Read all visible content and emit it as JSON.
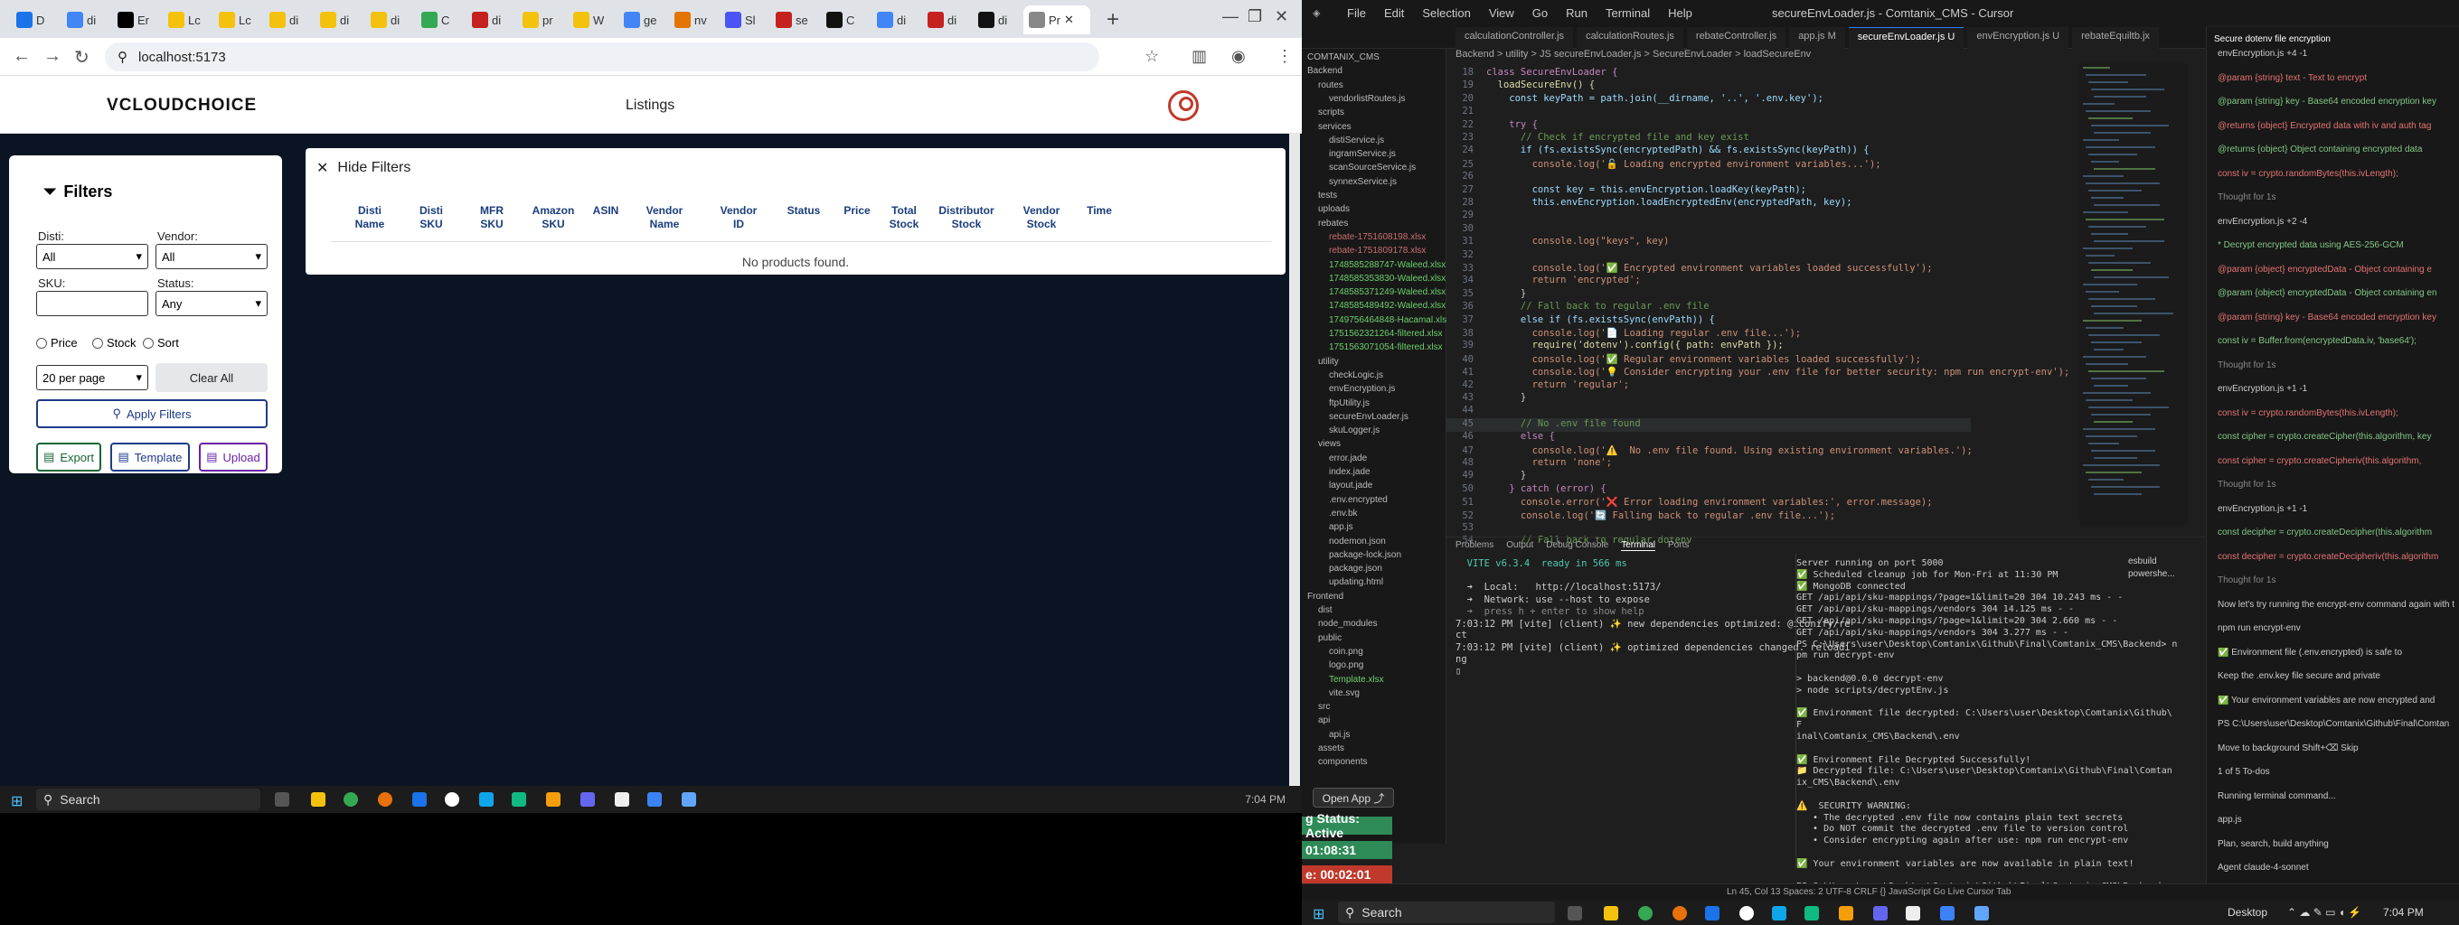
{
  "browser": {
    "tabs": [
      {
        "label": "D",
        "color": "#1a73e8"
      },
      {
        "label": "di",
        "color": "#4285f4"
      },
      {
        "label": "Er",
        "color": "#000000"
      },
      {
        "label": "Lc",
        "color": "#f4c20d"
      },
      {
        "label": "Lc",
        "color": "#f4c20d"
      },
      {
        "label": "di",
        "color": "#f4c20d"
      },
      {
        "label": "di",
        "color": "#f4c20d"
      },
      {
        "label": "di",
        "color": "#f4c20d"
      },
      {
        "label": "C",
        "color": "#34a853"
      },
      {
        "label": "di",
        "color": "#c5221f"
      },
      {
        "label": "pr",
        "color": "#f4c20d"
      },
      {
        "label": "W",
        "color": "#f4c20d"
      },
      {
        "label": "ge",
        "color": "#4285f4"
      },
      {
        "label": "nv",
        "color": "#e37400"
      },
      {
        "label": "Sl",
        "color": "#4b53f5"
      },
      {
        "label": "se",
        "color": "#c5221f"
      },
      {
        "label": "C",
        "color": "#111111"
      },
      {
        "label": "di",
        "color": "#4285f4"
      },
      {
        "label": "di",
        "color": "#c5221f"
      },
      {
        "label": "di",
        "color": "#111111"
      },
      {
        "label": "Pr",
        "color": "#888888"
      }
    ],
    "url": "localhost:5173"
  },
  "app": {
    "logo": {
      "v": "V",
      "text": "CLOUDCHOICE"
    },
    "nav_title": "Listings",
    "filters": {
      "title": "Filters",
      "disti_label": "Disti:",
      "disti_value": "All",
      "vendor_label": "Vendor:",
      "vendor_value": "All",
      "sku_label": "SKU:",
      "sku_value": "",
      "status_label": "Status:",
      "status_value": "Any",
      "radios": [
        "Price",
        "Stock",
        "Sort"
      ],
      "per_page": "20 per page",
      "clear_all": "Clear All",
      "apply": "Apply Filters",
      "export": "Export",
      "template": "Template",
      "upload": "Upload"
    },
    "hide_filters": "Hide Filters",
    "columns": [
      "Disti\nName",
      "Disti\nSKU",
      "MFR\nSKU",
      "Amazon\nSKU",
      "ASIN",
      "Vendor\nName",
      "Vendor\nID",
      "Status",
      "Price",
      "Total\nStock",
      "Distributor\nStock",
      "Vendor\nStock",
      "Time"
    ],
    "empty_message": "No products found."
  },
  "left_taskbar": {
    "search": "Search",
    "time": "7:04 PM"
  },
  "ide": {
    "menu": [
      "File",
      "Edit",
      "Selection",
      "View",
      "Go",
      "Run",
      "Terminal",
      "Help"
    ],
    "title": "secureEnvLoader.js - Comtanix_CMS - Cursor",
    "tabs": [
      "calculationController.js",
      "calculationRoutes.js",
      "rebateController.js",
      "app.js  M",
      "secureEnvLoader.js  U",
      "envEncryption.js  U",
      "rebateEquiltb.jx"
    ],
    "active_tab_index": 4,
    "breadcrumb": "Backend > utility > JS secureEnvLoader.js > SecureEnvLoader > loadSecureEnv",
    "explorer": [
      "COMTANIX_CMS",
      "Backend",
      "routes",
      "vendorlistRoutes.js",
      "scripts",
      "services",
      "distiService.js",
      "ingramService.js",
      "scanSourceService.js",
      "synnexService.js",
      "tests",
      "uploads",
      "rebates",
      "rebate-1751608198.xlsx",
      "rebate-1751809178.xlsx",
      "1748585288747-Waleed.xlsx",
      "1748585353830-Waleed.xlsx",
      "1748585371249-Waleed.xlsx",
      "1748585489492-Waleed.xlsx",
      "1749756464848-Hacamal.xlsx",
      "1751562321264-filtered.xlsx",
      "1751563071054-filtered.xlsx",
      "utility",
      "checkLogic.js",
      "envEncryption.js",
      "ftpUtility.js",
      "secureEnvLoader.js",
      "skuLogger.js",
      "views",
      "error.jade",
      "index.jade",
      "layout.jade",
      ".env.encrypted",
      ".env.bk",
      "app.js",
      "nodemon.json",
      "package-lock.json",
      "package.json",
      "updating.html",
      "Frontend",
      "dist",
      "node_modules",
      "public",
      "coin.png",
      "logo.png",
      "Template.xlsx",
      "vite.svg",
      "src",
      "api",
      "api.js",
      "assets",
      "components"
    ],
    "code": [
      {
        "n": "18",
        "t": "class SecureEnvLoader {",
        "c": "#c586c0"
      },
      {
        "n": "19",
        "t": "  loadSecureEnv() {",
        "c": "#dcdcaa"
      },
      {
        "n": "20",
        "t": "    const keyPath = path.join(__dirname, '..', '.env.key');",
        "c": "#9cdcfe"
      },
      {
        "n": "21",
        "t": "",
        "c": "#ccc"
      },
      {
        "n": "22",
        "t": "    try {",
        "c": "#c586c0"
      },
      {
        "n": "23",
        "t": "      // Check if encrypted file and key exist",
        "c": "#6a9955"
      },
      {
        "n": "24",
        "t": "      if (fs.existsSync(encryptedPath) && fs.existsSync(keyPath)) {",
        "c": "#9cdcfe"
      },
      {
        "n": "25",
        "t": "        console.log('🔓 Loading encrypted environment variables...');",
        "c": "#ce9178"
      },
      {
        "n": "26",
        "t": "",
        "c": "#ccc"
      },
      {
        "n": "27",
        "t": "        const key = this.envEncryption.loadKey(keyPath);",
        "c": "#9cdcfe"
      },
      {
        "n": "28",
        "t": "        this.envEncryption.loadEncryptedEnv(encryptedPath, key);",
        "c": "#9cdcfe"
      },
      {
        "n": "29",
        "t": "",
        "c": "#ccc"
      },
      {
        "n": "30",
        "t": "",
        "c": "#ccc"
      },
      {
        "n": "31",
        "t": "        console.log(\"keys\", key)",
        "c": "#ce9178"
      },
      {
        "n": "32",
        "t": "",
        "c": "#ccc"
      },
      {
        "n": "33",
        "t": "        console.log('✅ Encrypted environment variables loaded successfully');",
        "c": "#ce9178"
      },
      {
        "n": "34",
        "t": "        return 'encrypted';",
        "c": "#ce9178"
      },
      {
        "n": "35",
        "t": "      }",
        "c": "#ccc"
      },
      {
        "n": "36",
        "t": "      // Fall back to regular .env file",
        "c": "#6a9955"
      },
      {
        "n": "37",
        "t": "      else if (fs.existsSync(envPath)) {",
        "c": "#9cdcfe"
      },
      {
        "n": "38",
        "t": "        console.log('📄 Loading regular .env file...');",
        "c": "#ce9178"
      },
      {
        "n": "39",
        "t": "        require('dotenv').config({ path: envPath });",
        "c": "#dcdcaa"
      },
      {
        "n": "40",
        "t": "        console.log('✅ Regular environment variables loaded successfully');",
        "c": "#ce9178"
      },
      {
        "n": "41",
        "t": "        console.log('💡 Consider encrypting your .env file for better security: npm run encrypt-env');",
        "c": "#ce9178"
      },
      {
        "n": "42",
        "t": "        return 'regular';",
        "c": "#ce9178"
      },
      {
        "n": "43",
        "t": "      }",
        "c": "#ccc"
      },
      {
        "n": "44",
        "t": "",
        "c": "#ccc"
      },
      {
        "n": "45",
        "t": "      // No .env file found",
        "c": "#6a9955"
      },
      {
        "n": "46",
        "t": "      else {",
        "c": "#c586c0"
      },
      {
        "n": "47",
        "t": "        console.log('⚠️  No .env file found. Using existing environment variables.');",
        "c": "#ce9178"
      },
      {
        "n": "48",
        "t": "        return 'none';",
        "c": "#ce9178"
      },
      {
        "n": "49",
        "t": "      }",
        "c": "#ccc"
      },
      {
        "n": "50",
        "t": "    } catch (error) {",
        "c": "#c586c0"
      },
      {
        "n": "51",
        "t": "      console.error('❌ Error loading environment variables:', error.message);",
        "c": "#ce9178"
      },
      {
        "n": "52",
        "t": "      console.log('🔄 Falling back to regular .env file...');",
        "c": "#ce9178"
      },
      {
        "n": "53",
        "t": "",
        "c": "#ccc"
      },
      {
        "n": "54",
        "t": "      // Fall back to regular dotenv",
        "c": "#6a9955"
      }
    ],
    "panel_tabs": [
      "Problems",
      "Output",
      "Debug Console",
      "Terminal",
      "Ports"
    ],
    "term_left": [
      {
        "t": "  VITE v6.3.4  ready in 566 ms",
        "c": "#4ec9b0"
      },
      {
        "t": "",
        "c": "#ccc"
      },
      {
        "t": "  ➜  Local:   http://localhost:5173/",
        "c": "#ccc"
      },
      {
        "t": "  ➜  Network: use --host to expose",
        "c": "#ccc"
      },
      {
        "t": "  ➜  press h + enter to show help",
        "c": "#888"
      },
      {
        "t": "7:03:12 PM [vite] (client) ✨ new dependencies optimized: @iconify/re",
        "c": "#ccc"
      },
      {
        "t": "ct",
        "c": "#ccc"
      },
      {
        "t": "7:03:12 PM [vite] (client) ✨ optimized dependencies changed. reloadi",
        "c": "#ccc"
      },
      {
        "t": "ng",
        "c": "#ccc"
      },
      {
        "t": "▯",
        "c": "#ccc"
      }
    ],
    "term_right": [
      {
        "t": "Server running on port 5000",
        "c": "#ccc"
      },
      {
        "t": "✅ Scheduled cleanup job for Mon-Fri at 11:30 PM",
        "c": "#ccc"
      },
      {
        "t": "✅ MongoDB connected",
        "c": "#ccc"
      },
      {
        "t": "GET /api/api/sku-mappings/?page=1&limit=20 304 10.243 ms - -",
        "c": "#ccc"
      },
      {
        "t": "GET /api/api/sku-mappings/vendors 304 14.125 ms - -",
        "c": "#ccc"
      },
      {
        "t": "GET /api/api/sku-mappings/?page=1&limit=20 304 2.660 ms - -",
        "c": "#ccc"
      },
      {
        "t": "GET /api/api/sku-mappings/vendors 304 3.277 ms - -",
        "c": "#ccc"
      },
      {
        "t": "PS C:\\Users\\user\\Desktop\\Comtanix\\Github\\Final\\Comtanix_CMS\\Backend> n",
        "c": "#ccc"
      },
      {
        "t": "pm run decrypt-env",
        "c": "#ccc"
      },
      {
        "t": "",
        "c": "#ccc"
      },
      {
        "t": "> backend@0.0.0 decrypt-env",
        "c": "#ccc"
      },
      {
        "t": "> node scripts/decryptEnv.js",
        "c": "#ccc"
      },
      {
        "t": "",
        "c": "#ccc"
      },
      {
        "t": "✅ Environment file decrypted: C:\\Users\\user\\Desktop\\Comtanix\\Github\\",
        "c": "#ccc"
      },
      {
        "t": "F",
        "c": "#ccc"
      },
      {
        "t": "inal\\Comtanix_CMS\\Backend\\.env",
        "c": "#ccc"
      },
      {
        "t": "",
        "c": "#ccc"
      },
      {
        "t": "✅ Environment File Decrypted Successfully!",
        "c": "#ccc"
      },
      {
        "t": "📁 Decrypted file: C:\\Users\\user\\Desktop\\Comtanix\\Github\\Final\\Comtan",
        "c": "#ccc"
      },
      {
        "t": "ix_CMS\\Backend\\.env",
        "c": "#ccc"
      },
      {
        "t": "",
        "c": "#ccc"
      },
      {
        "t": "⚠️  SECURITY WARNING:",
        "c": "#ccc"
      },
      {
        "t": "   • The decrypted .env file now contains plain text secrets",
        "c": "#ccc"
      },
      {
        "t": "   • Do NOT commit the decrypted .env file to version control",
        "c": "#ccc"
      },
      {
        "t": "   • Consider encrypting again after use: npm run encrypt-env",
        "c": "#ccc"
      },
      {
        "t": "",
        "c": "#ccc"
      },
      {
        "t": "✅ Your environment variables are now available in plain text!",
        "c": "#ccc"
      },
      {
        "t": "",
        "c": "#ccc"
      },
      {
        "t": "PS C:\\Users\\user\\Desktop\\Comtanix\\Github\\Final\\Comtanix_CMS\\Backend>▯",
        "c": "#ccc"
      }
    ],
    "term_list": [
      "esbuild",
      "powershe..."
    ],
    "chat": {
      "title": "Secure dotenv file encryption",
      "blocks": [
        "envEncryption.js +4 -1",
        "@param {string} text - Text to encrypt",
        "@param {string} key - Base64 encoded encryption key",
        "@returns {object} Encrypted data with iv and auth tag",
        "@returns {object} Object containing encrypted data",
        "const iv = crypto.randomBytes(this.ivLength);",
        "Thought for 1s",
        "envEncryption.js +2 -4",
        "* Decrypt encrypted data using AES-256-GCM",
        "@param {object} encryptedData - Object containing e",
        "@param {object} encryptedData - Object containing en",
        "@param {string} key - Base64 encoded encryption key",
        "const iv = Buffer.from(encryptedData.iv, 'base64');",
        "Thought for 1s",
        "envEncryption.js +1 -1",
        "const iv = crypto.randomBytes(this.ivLength);",
        "const cipher = crypto.createCipher(this.algorithm, key",
        "const cipher = crypto.createCipheriv(this.algorithm,",
        "Thought for 1s",
        "envEncryption.js +1 -1",
        "const decipher = crypto.createDecipher(this.algorithm",
        "const decipher = crypto.createDecipheriv(this.algorithm",
        "Thought for 1s",
        "Now let's try running the encrypt-env command again with the fixed crypto functions:",
        "npm run encrypt-env",
        "✅ Environment file (.env.encrypted) is safe to",
        "   Keep the .env.key file secure and private",
        "✅ Your environment variables are now encrypted and",
        "PS C:\\Users\\user\\Desktop\\Comtanix\\Github\\Final\\Comtan",
        "Move to background   Shift+⌫ Skip",
        "1 of 5 To-dos",
        "Running terminal command...",
        "app.js",
        "Plan, search, build anything",
        "Agent  claude-4-sonnet"
      ]
    },
    "status": "Ln 45, Col 13   Spaces: 2   UTF-8   CRLF   {} JavaScript   Go Live   Cursor Tab",
    "open_app": "Open App ⤴",
    "timers": [
      {
        "label": "g Status: Active",
        "color": "#2e8b57"
      },
      {
        "label": "01:08:31",
        "color": "#2e8b57"
      },
      {
        "label": "e: 00:02:01",
        "color": "#c0392b"
      }
    ]
  },
  "right_taskbar": {
    "search": "Search",
    "desktop": "Desktop",
    "time": "7:04 PM"
  }
}
